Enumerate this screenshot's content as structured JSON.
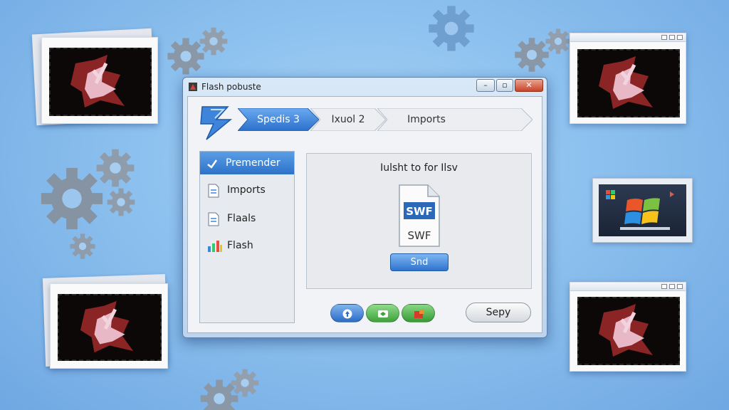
{
  "window": {
    "title": "Flash pobuste",
    "controls": {
      "minimize": "–",
      "maximize": "▫",
      "close": "✕"
    }
  },
  "wizard": {
    "steps": [
      {
        "label": "Spedis 3",
        "active": true
      },
      {
        "label": "Ixuol 2",
        "active": false
      },
      {
        "label": "Imports",
        "active": false
      }
    ]
  },
  "sidebar": {
    "items": [
      {
        "label": "Premender",
        "icon": "check-icon",
        "active": true
      },
      {
        "label": "Imports",
        "icon": "document-icon",
        "active": false
      },
      {
        "label": "Flaals",
        "icon": "document-icon",
        "active": false
      },
      {
        "label": "Flash",
        "icon": "chart-icon",
        "active": false
      }
    ]
  },
  "panel": {
    "title": "Iulsht to for Ilsv",
    "file_badge": "SWF",
    "file_label": "SWF",
    "send_button": "Snd"
  },
  "footer": {
    "skip_button": "Sepy"
  },
  "colors": {
    "accent": "#2e72c9",
    "close": "#c8442a",
    "green": "#3ea23b",
    "background": "#8cc0ee"
  }
}
